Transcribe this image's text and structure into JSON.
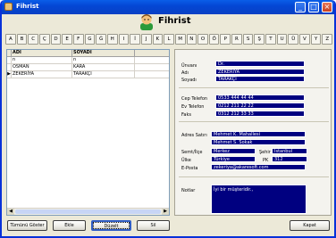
{
  "window": {
    "title": "Fihrist"
  },
  "header": {
    "title": "Fihrist"
  },
  "alphabet": [
    "A",
    "B",
    "C",
    "Ç",
    "D",
    "E",
    "F",
    "G",
    "Ğ",
    "H",
    "I",
    "İ",
    "J",
    "K",
    "L",
    "M",
    "N",
    "O",
    "Ö",
    "P",
    "R",
    "S",
    "Ş",
    "T",
    "U",
    "Ü",
    "V",
    "Y",
    "Z"
  ],
  "grid": {
    "columns": [
      "ADI",
      "SOYADI"
    ],
    "rows": [
      {
        "indicator": "",
        "adi": "n",
        "soyadi": "n"
      },
      {
        "indicator": "",
        "adi": "OSMAN",
        "soyadi": "KARA"
      },
      {
        "indicator": "▶",
        "adi": "ZEKERİYA",
        "soyadi": "TARAKÇI"
      }
    ]
  },
  "details": {
    "labels": {
      "unvan": "Ünvanı",
      "adi": "Adı",
      "soyadi": "Soyadı",
      "cep": "Cep Telefon",
      "ev": "Ev Telefon",
      "faks": "Faks",
      "adres": "Adres Satırı",
      "semt": "Semt/İlçe",
      "sehir": "Şehir",
      "ulke": "Ülke",
      "pk": "PK",
      "eposta": "E-Posta",
      "notlar": "Notlar"
    },
    "values": {
      "unvan": "Dr.",
      "adi": "ZEKERİYA",
      "soyadi": "TARAKÇI",
      "cep": "0533 444 44 44",
      "ev": "0212 211 22 22",
      "faks": "0312 212 33 33",
      "adres1": "Mehmet K. Mahallesi",
      "adres2": "Mehmet S. Sokak",
      "semt": "Merkez",
      "sehir": "İstanbul",
      "ulke": "Türkiye",
      "pk": "312",
      "eposta": "zekeriya@akaresoft.com",
      "notlar": "İyi bir müşteridir.,"
    }
  },
  "buttons": {
    "tumunu": "Tümünü Göster",
    "ekle": "Ekle",
    "duzelt": "Düzelt",
    "sil": "Sil",
    "kapat": "Kapat"
  },
  "colors": {
    "field_bg": "#000080",
    "titlebar": "#0447d5",
    "window_bg": "#ece9d8"
  }
}
